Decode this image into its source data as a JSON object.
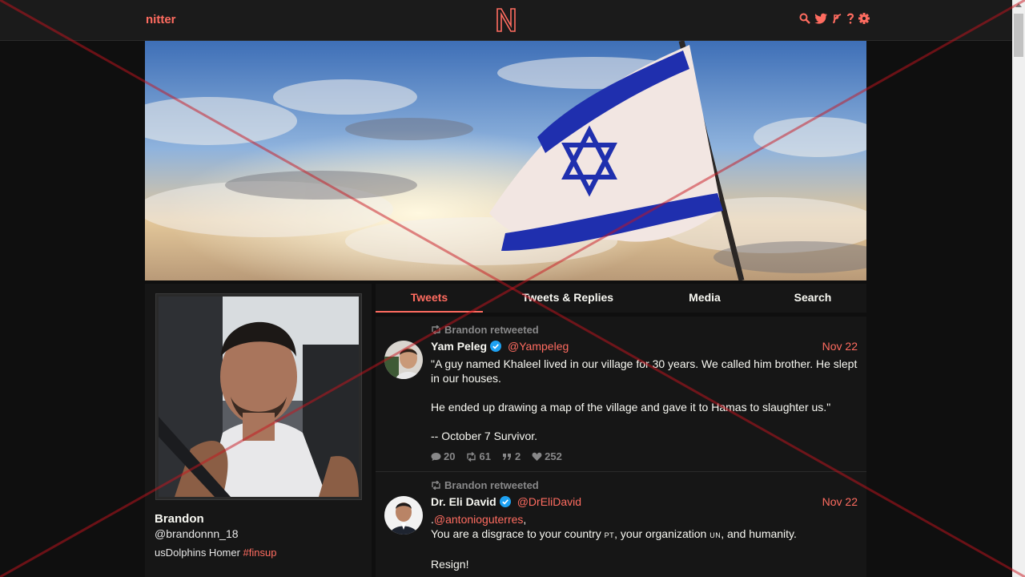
{
  "navbar": {
    "brand": "nitter",
    "logo_letter": "N",
    "icons": [
      "search-icon",
      "twitter-icon",
      "rss-icon",
      "help-icon",
      "gear-icon"
    ],
    "accent": "#ff6c60"
  },
  "profile": {
    "fullname": "Brandon",
    "username": "@brandonnn_18",
    "bio_text": "usDolphins Homer ",
    "bio_hashtag": "#finsup"
  },
  "tabs": [
    {
      "label": "Tweets",
      "active": true
    },
    {
      "label": "Tweets & Replies",
      "active": false
    },
    {
      "label": "Media",
      "active": false
    },
    {
      "label": "Search",
      "active": false
    }
  ],
  "tweets": [
    {
      "retweet_header": "Brandon retweeted",
      "fullname": "Yam Peleg",
      "username": "@Yampeleg",
      "date": "Nov 22",
      "body_lines": [
        "\"A guy named Khaleel lived in our village for 30 years. We called him brother. He slept in our houses.",
        "He ended up drawing a map of the village and gave it to Hamas to slaughter us.\"",
        "-- October 7 Survivor."
      ],
      "stats": {
        "replies": "20",
        "retweets": "61",
        "quotes": "2",
        "likes": "252"
      }
    },
    {
      "retweet_header": "Brandon retweeted",
      "fullname": "Dr. Eli David",
      "username": "@DrEliDavid",
      "date": "Nov 22",
      "line1_prefix": ".",
      "line1_mention": "@antonioguterres",
      "line1_suffix": ",",
      "line2_a": "You are a disgrace to your country ",
      "line2_sc1": "PT",
      "line2_b": ", your organization ",
      "line2_sc2": "UN",
      "line2_c": ", and humanity.",
      "line3": "Resign!"
    }
  ]
}
